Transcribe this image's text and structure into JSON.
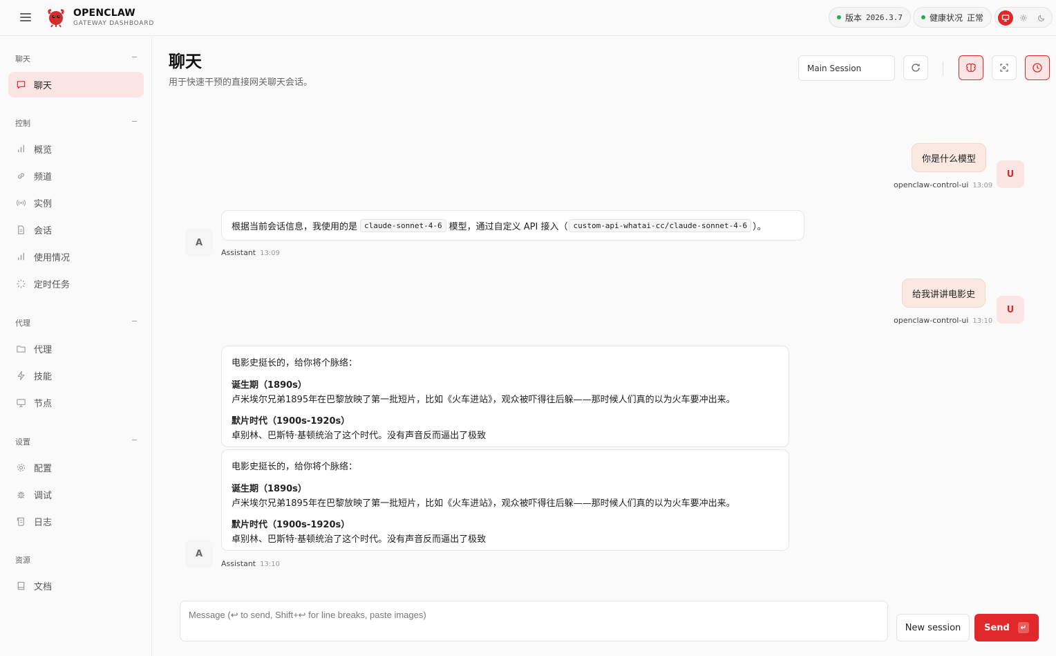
{
  "brand": {
    "title": "OPENCLAW",
    "subtitle": "GATEWAY DASHBOARD"
  },
  "status": {
    "version_label": "版本",
    "version_value": "2026.3.7",
    "health_label": "健康状况",
    "health_value": "正常"
  },
  "colors": {
    "accent": "#e0282a",
    "accent_soft": "#fbe4e4",
    "ok": "#22b04b"
  },
  "sidebar": {
    "sections": [
      {
        "title": "聊天",
        "toggle": "−",
        "items": [
          {
            "label": "聊天",
            "icon": "chat-icon",
            "active": true
          }
        ]
      },
      {
        "title": "控制",
        "toggle": "−",
        "items": [
          {
            "label": "概览",
            "icon": "bar-chart-icon"
          },
          {
            "label": "频道",
            "icon": "link-icon"
          },
          {
            "label": "实例",
            "icon": "broadcast-icon"
          },
          {
            "label": "会话",
            "icon": "document-icon"
          },
          {
            "label": "使用情况",
            "icon": "bar-chart-icon"
          },
          {
            "label": "定时任务",
            "icon": "loader-icon"
          }
        ]
      },
      {
        "title": "代理",
        "toggle": "−",
        "items": [
          {
            "label": "代理",
            "icon": "folder-icon"
          },
          {
            "label": "技能",
            "icon": "zap-icon"
          },
          {
            "label": "节点",
            "icon": "monitor-icon"
          }
        ]
      },
      {
        "title": "设置",
        "toggle": "−",
        "items": [
          {
            "label": "配置",
            "icon": "gear-icon"
          },
          {
            "label": "调试",
            "icon": "bug-icon"
          },
          {
            "label": "日志",
            "icon": "scroll-icon"
          }
        ]
      },
      {
        "title": "资源",
        "items": [
          {
            "label": "文档",
            "icon": "book-icon"
          }
        ]
      }
    ]
  },
  "page": {
    "title": "聊天",
    "subtitle": "用于快速干预的直接网关聊天会话。"
  },
  "toolbar": {
    "session": "Main Session"
  },
  "messages": {
    "m1": {
      "text": "你是什么模型",
      "sender": "openclaw-control-ui",
      "time": "13:09",
      "avatar": "U"
    },
    "m2": {
      "pre": "根据当前会话信息，我使用的是",
      "code1": "claude-sonnet-4-6",
      "mid": "模型，通过自定义 API 接入（",
      "code2": "custom-api-whatai-cc/claude-sonnet-4-6",
      "post": "）。",
      "sender": "Assistant",
      "time": "13:09",
      "avatar": "A"
    },
    "m3": {
      "text": "给我讲讲电影史",
      "sender": "openclaw-control-ui",
      "time": "13:10",
      "avatar": "U"
    },
    "m4": {
      "intro": "电影史挺长的，给你将个脉络：",
      "h1": "诞生期（1890s）",
      "p1": "卢米埃尔兄弟1895年在巴黎放映了第一批短片，比如《火车进站》，观众被吓得往后躲——那时候人们真的以为火车要冲出来。",
      "h2": "默片时代（1900s-1920s）",
      "p2": "卓别林、巴斯特·基顿统治了这个时代。没有声音反而逼出了极致",
      "sender": "Assistant",
      "time": "13:10",
      "avatar": "A"
    }
  },
  "composer": {
    "placeholder": "Message (↩ to send, Shift+↩ for line breaks, paste images)",
    "new_session": "New session",
    "send": "Send",
    "send_key": "↵"
  }
}
